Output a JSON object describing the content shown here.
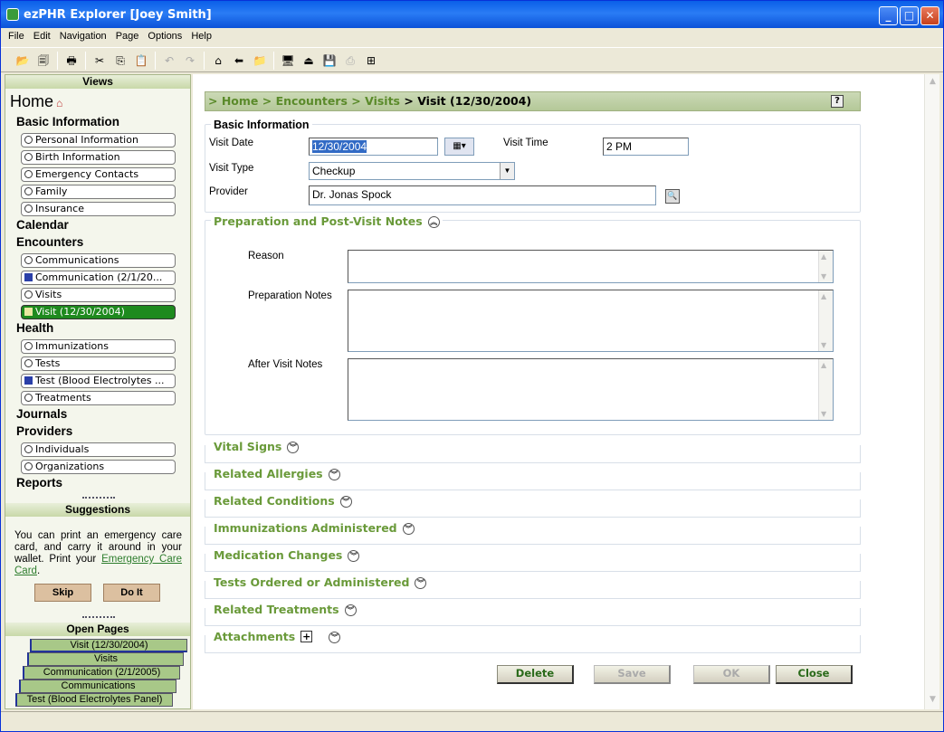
{
  "window": {
    "title": "ezPHR Explorer [Joey Smith]",
    "minimize": "_",
    "maximize": "□",
    "close": "✕"
  },
  "menu": [
    "File",
    "Edit",
    "Navigation",
    "Page",
    "Options",
    "Help"
  ],
  "toolbar": {
    "icons": [
      "open-folder-icon",
      "copy-pages-icon",
      "print-icon",
      "cut-icon",
      "copy-icon",
      "paste-icon",
      "undo-icon",
      "redo-icon",
      "home-icon",
      "back-icon",
      "folder-icon",
      "monitor-icon",
      "eject-icon",
      "save-icon",
      "save-as-icon",
      "add-icon"
    ],
    "glyphs": [
      "📂",
      "🗐",
      "🖶",
      "✂",
      "⎘",
      "📋",
      "↶",
      "↷",
      "⌂",
      "⬅",
      "📁",
      "🖥",
      "⏏",
      "💾",
      "⎙",
      "⊞"
    ]
  },
  "sidebar": {
    "views_header": "Views",
    "home": "Home",
    "sections": {
      "basic": "Basic Information",
      "calendar": "Calendar",
      "encounters": "Encounters",
      "health": "Health",
      "journals": "Journals",
      "providers": "Providers",
      "reports": "Reports"
    },
    "items": {
      "personal": "Personal Information",
      "birth": "Birth Information",
      "emergency": "Emergency Contacts",
      "family": "Family",
      "insurance": "Insurance",
      "communications": "Communications",
      "communication_doc": "Communication (2/1/20...",
      "visits": "Visits",
      "visit_doc": "Visit (12/30/2004)",
      "immunizations": "Immunizations",
      "tests": "Tests",
      "test_doc": "Test (Blood Electrolytes ...",
      "treatments": "Treatments",
      "individuals": "Individuals",
      "organizations": "Organizations"
    },
    "suggestions_header": "Suggestions",
    "suggestion_text": "You can print an emergency care card, and carry it around in your wallet. Print your",
    "suggestion_link": "Emergency Care Card",
    "suggestion_end": ".",
    "skip": "Skip",
    "do_it": "Do It",
    "open_pages_header": "Open Pages",
    "open_pages": [
      "Visit (12/30/2004)",
      "Visits",
      "Communication (2/1/2005)",
      "Communications",
      "Test (Blood Electrolytes Panel)"
    ]
  },
  "breadcrumb": {
    "prefix": ">",
    "home": "Home",
    "sep": ">",
    "encounters": "Encounters",
    "visits": "Visits",
    "current": "Visit (12/30/2004)",
    "help": "?"
  },
  "form": {
    "basic_title": "Basic Information",
    "visit_date_label": "Visit Date",
    "visit_date": "12/30/2004",
    "visit_time_label": "Visit Time",
    "visit_time": "2 PM",
    "visit_type_label": "Visit Type",
    "visit_type": "Checkup",
    "provider_label": "Provider",
    "provider": "Dr. Jonas Spock",
    "prep_title": "Preparation and Post-Visit Notes",
    "reason_label": "Reason",
    "prep_notes_label": "Preparation Notes",
    "after_notes_label": "After Visit Notes"
  },
  "sections": [
    "Vital Signs",
    "Related Allergies",
    "Related Conditions",
    "Immunizations Administered",
    "Medication Changes",
    "Tests Ordered or Administered",
    "Related Treatments",
    "Attachments"
  ],
  "buttons": {
    "delete": "Delete",
    "save": "Save",
    "ok": "OK",
    "close": "Close"
  }
}
